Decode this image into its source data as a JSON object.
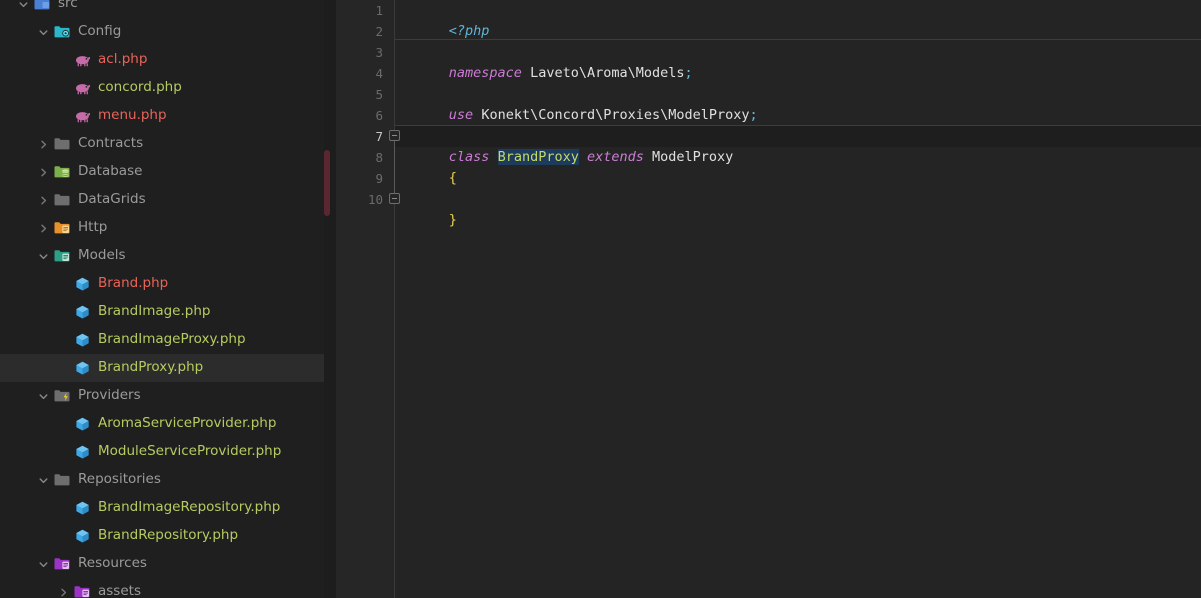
{
  "sidebar": {
    "name": "project-file-tree",
    "scrollbar_color": "#5a2730",
    "selected_file": "BrandProxy.php",
    "items": [
      {
        "label": "src",
        "depth": 1,
        "arrow": "down",
        "icon": "folder-src",
        "color": "dim",
        "partial": true
      },
      {
        "label": "Config",
        "depth": 2,
        "arrow": "down",
        "icon": "folder-config",
        "color": "dim"
      },
      {
        "label": "acl.php",
        "depth": 3,
        "arrow": "none",
        "icon": "php-file",
        "color": "red"
      },
      {
        "label": "concord.php",
        "depth": 3,
        "arrow": "none",
        "icon": "php-file",
        "color": "green"
      },
      {
        "label": "menu.php",
        "depth": 3,
        "arrow": "none",
        "icon": "php-file",
        "color": "red"
      },
      {
        "label": "Contracts",
        "depth": 2,
        "arrow": "right",
        "icon": "folder-plain",
        "color": "dim"
      },
      {
        "label": "Database",
        "depth": 2,
        "arrow": "right",
        "icon": "folder-database",
        "color": "dim"
      },
      {
        "label": "DataGrids",
        "depth": 2,
        "arrow": "right",
        "icon": "folder-plain",
        "color": "dim"
      },
      {
        "label": "Http",
        "depth": 2,
        "arrow": "right",
        "icon": "folder-http",
        "color": "dim"
      },
      {
        "label": "Models",
        "depth": 2,
        "arrow": "down",
        "icon": "folder-models",
        "color": "dim"
      },
      {
        "label": "Brand.php",
        "depth": 3,
        "arrow": "none",
        "icon": "php-class",
        "color": "red"
      },
      {
        "label": "BrandImage.php",
        "depth": 3,
        "arrow": "none",
        "icon": "php-class",
        "color": "green"
      },
      {
        "label": "BrandImageProxy.php",
        "depth": 3,
        "arrow": "none",
        "icon": "php-class",
        "color": "green"
      },
      {
        "label": "BrandProxy.php",
        "depth": 3,
        "arrow": "none",
        "icon": "php-class",
        "color": "green",
        "selected": true
      },
      {
        "label": "Providers",
        "depth": 2,
        "arrow": "down",
        "icon": "folder-providers",
        "color": "dim"
      },
      {
        "label": "AromaServiceProvider.php",
        "depth": 3,
        "arrow": "none",
        "icon": "php-class",
        "color": "green"
      },
      {
        "label": "ModuleServiceProvider.php",
        "depth": 3,
        "arrow": "none",
        "icon": "php-class",
        "color": "green"
      },
      {
        "label": "Repositories",
        "depth": 2,
        "arrow": "down",
        "icon": "folder-plain",
        "color": "dim"
      },
      {
        "label": "BrandImageRepository.php",
        "depth": 3,
        "arrow": "none",
        "icon": "php-class",
        "color": "green"
      },
      {
        "label": "BrandRepository.php",
        "depth": 3,
        "arrow": "none",
        "icon": "php-class",
        "color": "green"
      },
      {
        "label": "Resources",
        "depth": 2,
        "arrow": "down",
        "icon": "folder-resources",
        "color": "dim"
      },
      {
        "label": "assets",
        "depth": 3,
        "arrow": "right",
        "icon": "folder-resources",
        "color": "dim"
      }
    ]
  },
  "editor": {
    "name": "code-editor",
    "language": "php",
    "current_line": 7,
    "selection": "BrandProxy",
    "line_numbers": [
      "1",
      "2",
      "3",
      "4",
      "5",
      "6",
      "7",
      "8",
      "9",
      "10"
    ],
    "lines": [
      {
        "n": "1",
        "text": "<?php"
      },
      {
        "n": "2",
        "text": ""
      },
      {
        "n": "3",
        "text": "namespace Laveto\\Aroma\\Models;"
      },
      {
        "n": "4",
        "text": ""
      },
      {
        "n": "5",
        "text": "use Konekt\\Concord\\Proxies\\ModelProxy;"
      },
      {
        "n": "6",
        "text": ""
      },
      {
        "n": "7",
        "text": "class BrandProxy extends ModelProxy"
      },
      {
        "n": "8",
        "text": "{"
      },
      {
        "n": "9",
        "text": ""
      },
      {
        "n": "10",
        "text": "}"
      }
    ],
    "tokens": {
      "php_open": "<?php",
      "kw_namespace": "namespace",
      "namespace_value": "Laveto\\Aroma\\Models",
      "kw_use": "use",
      "use_value": "Konekt\\Concord\\Proxies\\ModelProxy",
      "kw_class": "class",
      "class_name": "BrandProxy",
      "kw_extends": "extends",
      "parent_class": "ModelProxy",
      "brace_open": "{",
      "brace_close": "}",
      "semicolon": ";"
    },
    "colors": {
      "background": "#242424",
      "gutter": "#262626",
      "current_line": "#1e1e1e",
      "selection": "#1d3b5c",
      "caret": "#f0c040",
      "keyword": "#cc7bd4",
      "php_tag": "#62b5d8",
      "brace": "#e8d44d",
      "text": "#e0e0e0"
    }
  }
}
